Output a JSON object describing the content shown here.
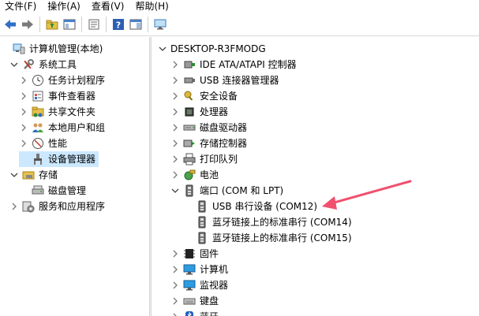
{
  "menu": [
    "文件(F)",
    "操作(A)",
    "查看(V)",
    "帮助(H)"
  ],
  "toolbar": [
    {
      "icon": "back-arrow-icon"
    },
    {
      "icon": "forward-arrow-icon"
    },
    {
      "icon": "up-folder-icon"
    },
    {
      "icon": "show-hide-tree-icon"
    },
    {
      "icon": "properties-icon"
    },
    {
      "icon": "help-icon"
    },
    {
      "icon": "action-pane-icon"
    },
    {
      "icon": "monitor-icon"
    }
  ],
  "left_tree": [
    {
      "label": "计算机管理(本地)",
      "icon": "computer-management-icon",
      "toggle": "",
      "level": 0
    },
    {
      "label": "系统工具",
      "icon": "tools-icon",
      "toggle": "expanded",
      "level": 1
    },
    {
      "label": "任务计划程序",
      "icon": "clock-icon",
      "toggle": "collapsed",
      "level": 2
    },
    {
      "label": "事件查看器",
      "icon": "event-viewer-icon",
      "toggle": "collapsed",
      "level": 2
    },
    {
      "label": "共享文件夹",
      "icon": "shared-folder-icon",
      "toggle": "collapsed",
      "level": 2
    },
    {
      "label": "本地用户和组",
      "icon": "users-icon",
      "toggle": "collapsed",
      "level": 2
    },
    {
      "label": "性能",
      "icon": "performance-icon",
      "toggle": "collapsed",
      "level": 2
    },
    {
      "label": "设备管理器",
      "icon": "device-manager-icon",
      "toggle": "",
      "level": 2,
      "selected": true
    },
    {
      "label": "存储",
      "icon": "storage-icon",
      "toggle": "expanded",
      "level": 1
    },
    {
      "label": "磁盘管理",
      "icon": "disk-management-icon",
      "toggle": "",
      "level": 2
    },
    {
      "label": "服务和应用程序",
      "icon": "services-icon",
      "toggle": "collapsed",
      "level": 1
    }
  ],
  "right_tree": [
    {
      "label": "DESKTOP-R3FMODG",
      "icon": "",
      "toggle": "expanded",
      "level": 0
    },
    {
      "label": "IDE ATA/ATAPI 控制器",
      "icon": "ide-controller-icon",
      "toggle": "collapsed",
      "level": 1
    },
    {
      "label": "USB 连接器管理器",
      "icon": "usb-connector-icon",
      "toggle": "collapsed",
      "level": 1
    },
    {
      "label": "安全设备",
      "icon": "security-device-icon",
      "toggle": "collapsed",
      "level": 1
    },
    {
      "label": "处理器",
      "icon": "processor-icon",
      "toggle": "collapsed",
      "level": 1
    },
    {
      "label": "磁盘驱动器",
      "icon": "disk-drive-icon",
      "toggle": "collapsed",
      "level": 1
    },
    {
      "label": "存储控制器",
      "icon": "storage-controller-icon",
      "toggle": "collapsed",
      "level": 1
    },
    {
      "label": "打印队列",
      "icon": "printer-icon",
      "toggle": "collapsed",
      "level": 1
    },
    {
      "label": "电池",
      "icon": "battery-icon",
      "toggle": "collapsed",
      "level": 1
    },
    {
      "label": "端口 (COM 和 LPT)",
      "icon": "port-icon",
      "toggle": "expanded",
      "level": 1
    },
    {
      "label": "USB 串行设备 (COM12)",
      "icon": "port-icon",
      "toggle": "",
      "level": 2
    },
    {
      "label": "蓝牙链接上的标准串行 (COM14)",
      "icon": "port-icon",
      "toggle": "",
      "level": 2
    },
    {
      "label": "蓝牙链接上的标准串行 (COM15)",
      "icon": "port-icon",
      "toggle": "",
      "level": 2
    },
    {
      "label": "固件",
      "icon": "firmware-icon",
      "toggle": "collapsed",
      "level": 1
    },
    {
      "label": "计算机",
      "icon": "computer-icon",
      "toggle": "collapsed",
      "level": 1
    },
    {
      "label": "监视器",
      "icon": "monitor-icon",
      "toggle": "collapsed",
      "level": 1
    },
    {
      "label": "键盘",
      "icon": "keyboard-icon",
      "toggle": "collapsed",
      "level": 1
    },
    {
      "label": "蓝牙",
      "icon": "bluetooth-icon",
      "toggle": "collapsed",
      "level": 1
    }
  ],
  "colors": {
    "selection": "#cce8ff",
    "annotation_arrow": "#f0506e"
  }
}
